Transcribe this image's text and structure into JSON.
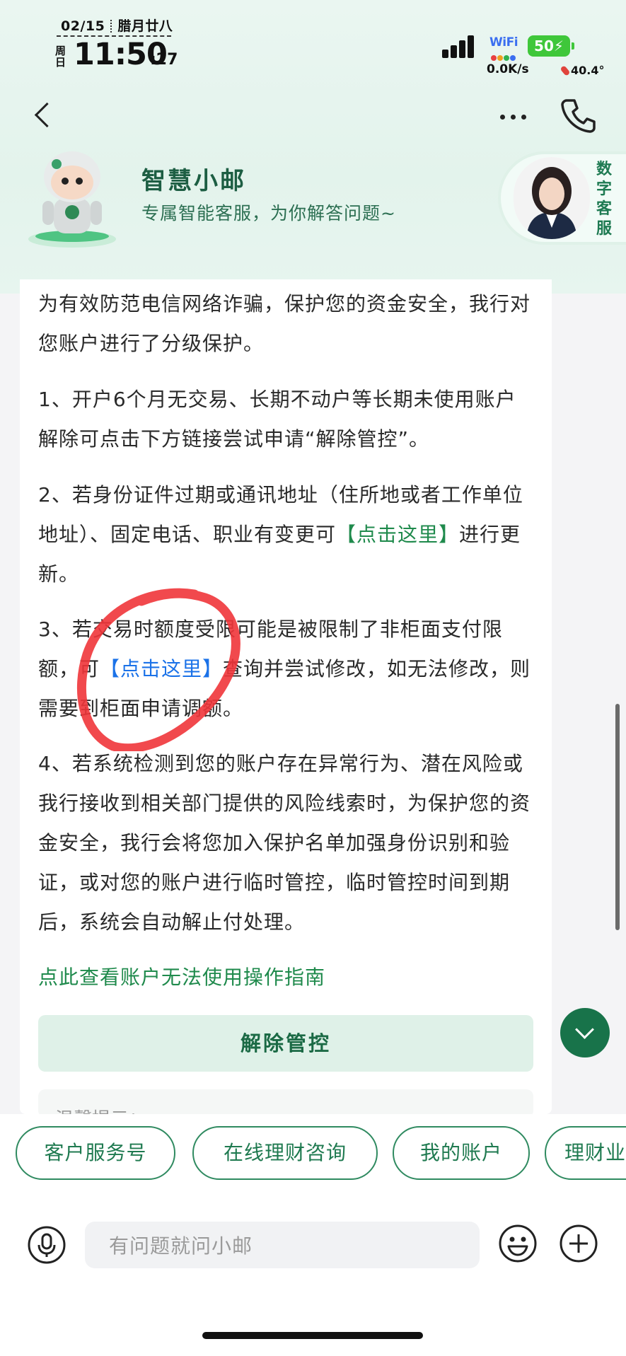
{
  "status_bar": {
    "date": "02/15",
    "lunar": "腊月廿八",
    "weekday": "周日",
    "time": "11:50",
    "seconds": ":27",
    "wifi_label": "WiFi",
    "battery": "50",
    "net_speed": "0.0K/s",
    "temperature": "40.4°"
  },
  "header": {
    "bot_name": "智慧小邮",
    "bot_desc": "专属智能客服，为你解答问题~",
    "digital_label": "数字客服"
  },
  "message": {
    "intro": "为有效防范电信网络诈骗，保护您的资金安全，我行对您账户进行了分级保护。",
    "item1": "1、开户6个月无交易、长期不动户等长期未使用账户解除可点击下方链接尝试申请“解除管控”。",
    "item2_pre": "2、若身份证件过期或通讯地址（住所地或者工作单位地址）、固定电话、职业有变更可",
    "item2_link": "【点击这里】",
    "item2_post": "进行更新。",
    "item3_pre": "3、若交易时额度受限可能是被限制了非柜面支付限额，可",
    "item3_link": "【点击这里】",
    "item3_post": "查询并尝试修改，如无法修改，则需要到柜面申请调额。",
    "item4": "4、若系统检测到您的账户存在异常行为、潜在风险或我行接收到相关部门提供的风险线索时，为保护您的资金安全，我行会将您加入保护名单加强身份识别和验证，或对您的账户进行临时管控，临时管控时间到期后，系统会自动解止付处理。",
    "guide_link": "点此查看账户无法使用操作指南",
    "release_button": "解除管控",
    "tip_partial": "温馨提示："
  },
  "quick_chips": [
    "客户服务号",
    "在线理财咨询",
    "我的账户",
    "理财业务"
  ],
  "input": {
    "placeholder": "有问题就问小邮"
  },
  "colors": {
    "brand_green": "#1f8a4c",
    "link_blue": "#1b72e8",
    "annotation_red": "#f0353a"
  }
}
